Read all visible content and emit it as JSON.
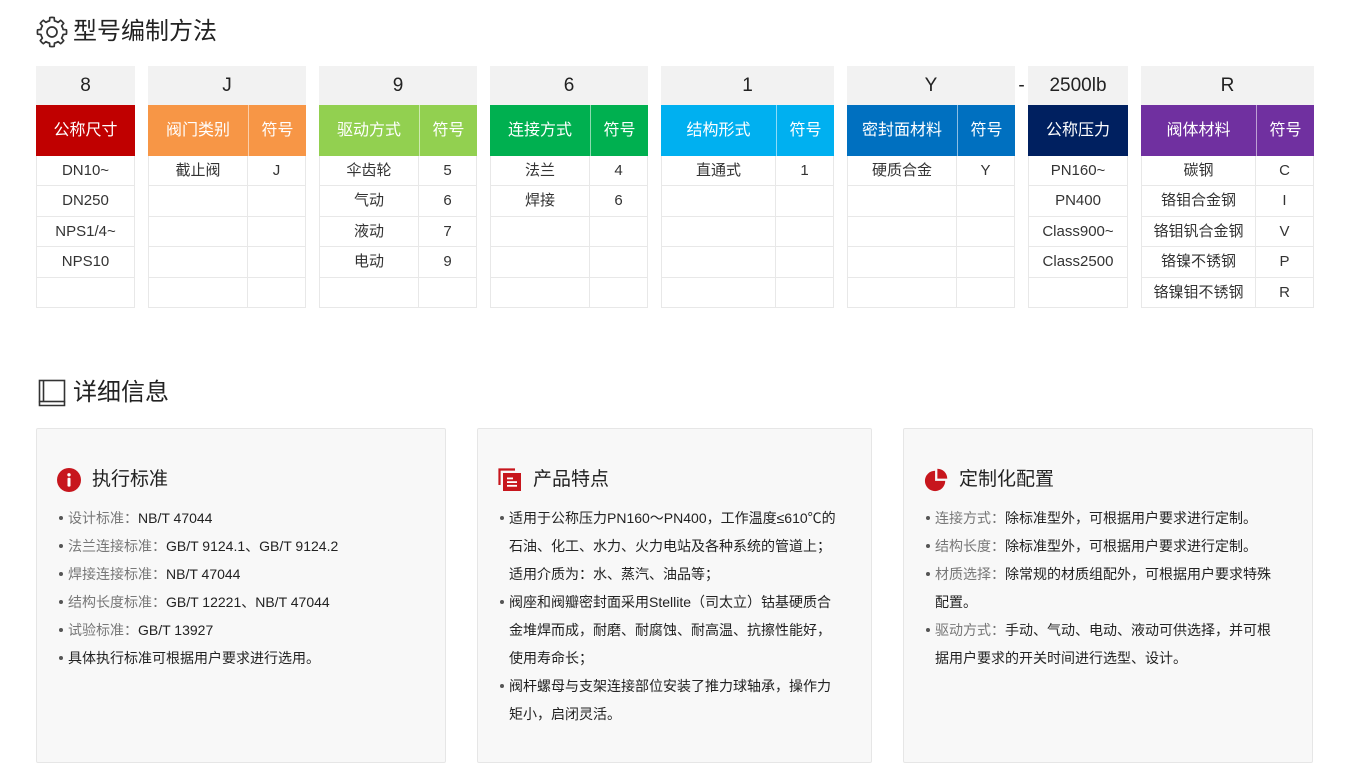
{
  "theme": {
    "accent": "#c7161d"
  },
  "sections": {
    "model": {
      "icon": "gear-icon",
      "title": "型号编制方法"
    },
    "details": {
      "icon": "book-icon",
      "title": "详细信息"
    }
  },
  "model_table": {
    "parts": [
      {
        "code": "8",
        "color": "#c00000",
        "columns": [
          {
            "header": "公称尺寸",
            "cells": [
              "DN10~",
              "DN250",
              "NPS1/4~",
              "NPS10"
            ]
          }
        ]
      },
      {
        "code": "J",
        "color": "#f79646",
        "columns": [
          {
            "header": "阀门类别",
            "cells": [
              "截止阀"
            ]
          },
          {
            "header": "符号",
            "cells": [
              "J"
            ]
          }
        ]
      },
      {
        "code": "9",
        "color": "#92d050",
        "columns": [
          {
            "header": "驱动方式",
            "cells": [
              "伞齿轮",
              "气动",
              "液动",
              "电动"
            ]
          },
          {
            "header": "符号",
            "cells": [
              "5",
              "6",
              "7",
              "9"
            ]
          }
        ]
      },
      {
        "code": "6",
        "color": "#00b050",
        "columns": [
          {
            "header": "连接方式",
            "cells": [
              "法兰",
              "焊接"
            ]
          },
          {
            "header": "符号",
            "cells": [
              "4",
              "6"
            ]
          }
        ]
      },
      {
        "code": "1",
        "color": "#00b0f0",
        "columns": [
          {
            "header": "结构形式",
            "cells": [
              "直通式"
            ]
          },
          {
            "header": "符号",
            "cells": [
              "1"
            ]
          }
        ]
      },
      {
        "code": "Y",
        "color": "#0070c0",
        "columns": [
          {
            "header": "密封面材料",
            "cells": [
              "硬质合金"
            ]
          },
          {
            "header": "符号",
            "cells": [
              "Y"
            ]
          }
        ]
      },
      {
        "separator": "-"
      },
      {
        "code": "2500lb",
        "color": "#002060",
        "columns": [
          {
            "header": "公称压力",
            "cells": [
              "PN160~",
              "PN400",
              "Class900~",
              "Class2500"
            ]
          }
        ]
      },
      {
        "code": "R",
        "color": "#7030a0",
        "columns": [
          {
            "header": "阀体材料",
            "cells": [
              "碳钢",
              "铬钼合金钢",
              "铬钼钒合金钢",
              "铬镍不锈钢",
              "铬镍钼不锈钢"
            ]
          },
          {
            "header": "符号",
            "cells": [
              "C",
              "I",
              "V",
              "P",
              "R"
            ]
          }
        ]
      }
    ]
  },
  "detail_cards": [
    {
      "icon": "info-circle-icon",
      "title": "执行标准",
      "items": [
        {
          "label": "设计标准：",
          "value": "NB/T 47044"
        },
        {
          "label": "法兰连接标准：",
          "value": "GB/T 9124.1、GB/T 9124.2"
        },
        {
          "label": "焊接连接标准：",
          "value": "NB/T 47044"
        },
        {
          "label": "结构长度标准：",
          "value": "GB/T 12221、NB/T 47044"
        },
        {
          "label": "试验标准：",
          "value": "GB/T 13927"
        },
        {
          "value": "具体执行标准可根据用户要求进行选用。"
        }
      ]
    },
    {
      "icon": "documents-icon",
      "title": "产品特点",
      "items": [
        {
          "value": "适用于公称压力PN160～PN400，工作温度≤610℃的石油、化工、水力、火力电站及各种系统的管道上；适用介质为：水、蒸汽、油品等；"
        },
        {
          "value": "阀座和阀瓣密封面采用Stellite（司太立）钴基硬质合金堆焊而成，耐磨、耐腐蚀、耐高温、抗擦性能好，使用寿命长；"
        },
        {
          "value": "阀杆螺母与支架连接部位安装了推力球轴承，操作力矩小，启闭灵活。"
        }
      ]
    },
    {
      "icon": "pie-chart-icon",
      "title": "定制化配置",
      "items": [
        {
          "label": "连接方式：",
          "value": "除标准型外，可根据用户要求进行定制。"
        },
        {
          "label": "结构长度：",
          "value": "除标准型外，可根据用户要求进行定制。"
        },
        {
          "label": "材质选择：",
          "value": "除常规的材质组配外，可根据用户要求特殊配置。"
        },
        {
          "label": "驱动方式：",
          "value": "手动、气动、电动、液动可供选择，并可根据用户要求的开关时间进行选型、设计。"
        }
      ]
    }
  ]
}
